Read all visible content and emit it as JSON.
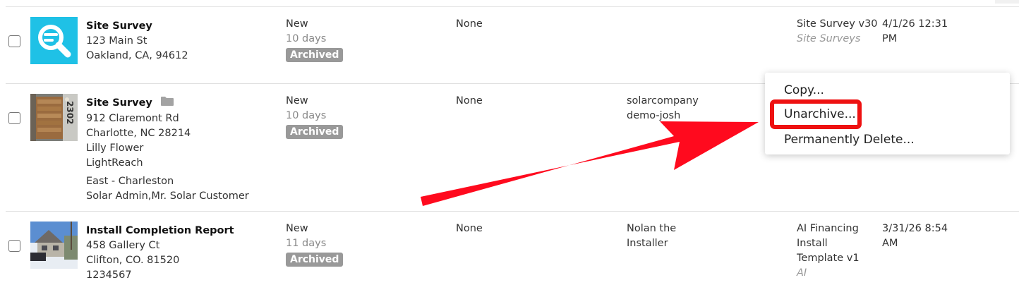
{
  "rows": [
    {
      "title": "Site Survey",
      "address": [
        "123 Main St",
        "Oakland, CA, 94612"
      ],
      "status": "New",
      "age": "10 days",
      "badge": "Archived",
      "flags": "None",
      "template": "Site Survey v30",
      "category": "Site Surveys",
      "date": [
        "4/1/26 12:31",
        "PM"
      ]
    },
    {
      "title": "Site Survey",
      "address": [
        "912 Claremont Rd",
        "Charlotte, NC 28214",
        "Lilly Flower",
        "LightReach"
      ],
      "extra": [
        "East - Charleston",
        "Solar Admin,Mr. Solar Customer"
      ],
      "status": "New",
      "age": "10 days",
      "badge": "Archived",
      "flags": "None",
      "assignee": [
        "solarcompany",
        "demo-josh"
      ]
    },
    {
      "title": "Install Completion Report",
      "address": [
        "458 Gallery Ct",
        "Clifton, CO. 81520",
        "1234567"
      ],
      "status": "New",
      "age": "11 days",
      "badge": "Archived",
      "flags": "None",
      "assignee": [
        "Nolan the",
        "Installer"
      ],
      "template": [
        "AI Financing",
        "Install",
        "Template v1"
      ],
      "category": "AI",
      "date": [
        "3/31/26 8:54",
        "AM"
      ]
    }
  ],
  "context_menu": {
    "items": [
      "Copy...",
      "Unarchive...",
      "Permanently Delete..."
    ]
  },
  "door_number": "2302",
  "colors": {
    "badge": "#999999",
    "highlight": "#ee1111",
    "arrow": "#ff0a1e",
    "survey_icon_bg": "#1fc1e6"
  }
}
